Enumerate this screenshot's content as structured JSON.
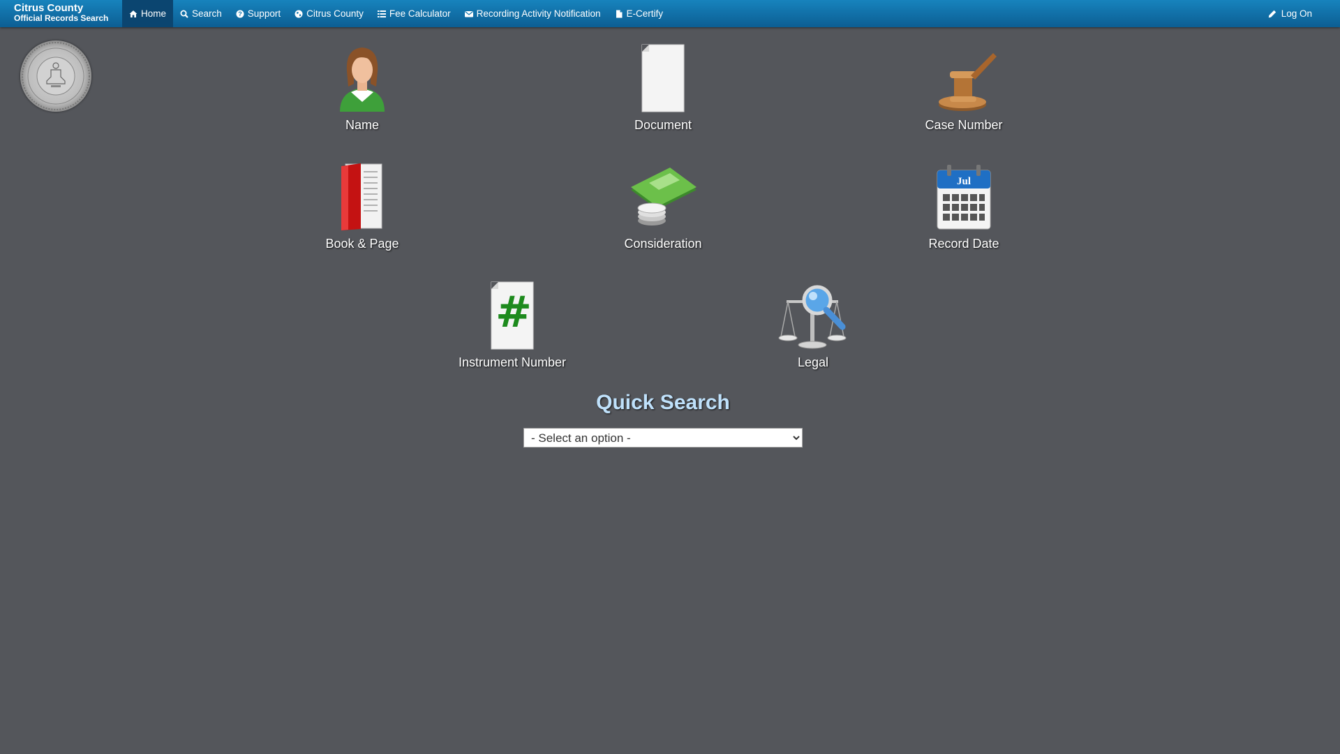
{
  "brand": {
    "title": "Citrus County",
    "subtitle": "Official Records Search"
  },
  "nav": {
    "items": [
      {
        "label": "Home",
        "icon": "home-icon",
        "active": true
      },
      {
        "label": "Search",
        "icon": "search-icon"
      },
      {
        "label": "Support",
        "icon": "question-circle-icon"
      },
      {
        "label": "Citrus County",
        "icon": "globe-icon"
      },
      {
        "label": "Fee Calculator",
        "icon": "list-icon"
      },
      {
        "label": "Recording Activity Notification",
        "icon": "envelope-icon"
      },
      {
        "label": "E-Certify",
        "icon": "file-icon"
      }
    ],
    "logon": {
      "label": "Log On",
      "icon": "pencil-icon"
    }
  },
  "tiles": [
    {
      "label": "Name",
      "icon": "person-icon"
    },
    {
      "label": "Document",
      "icon": "blank-document-icon"
    },
    {
      "label": "Case Number",
      "icon": "gavel-icon"
    },
    {
      "label": "Book & Page",
      "icon": "book-icon"
    },
    {
      "label": "Consideration",
      "icon": "money-icon"
    },
    {
      "label": "Record Date",
      "icon": "calendar-icon",
      "calendar_month": "Jul"
    },
    {
      "label": "Instrument Number",
      "icon": "hash-document-icon",
      "glyph": "#"
    },
    {
      "label": "Legal",
      "icon": "scales-magnifier-icon"
    }
  ],
  "quick_search": {
    "title": "Quick Search",
    "select_value": "- Select an option -"
  },
  "colors": {
    "background": "#54565b",
    "navbar": "#1378b0",
    "nav_active": "#0b4570",
    "quick_search_title": "#bfe1fb"
  }
}
